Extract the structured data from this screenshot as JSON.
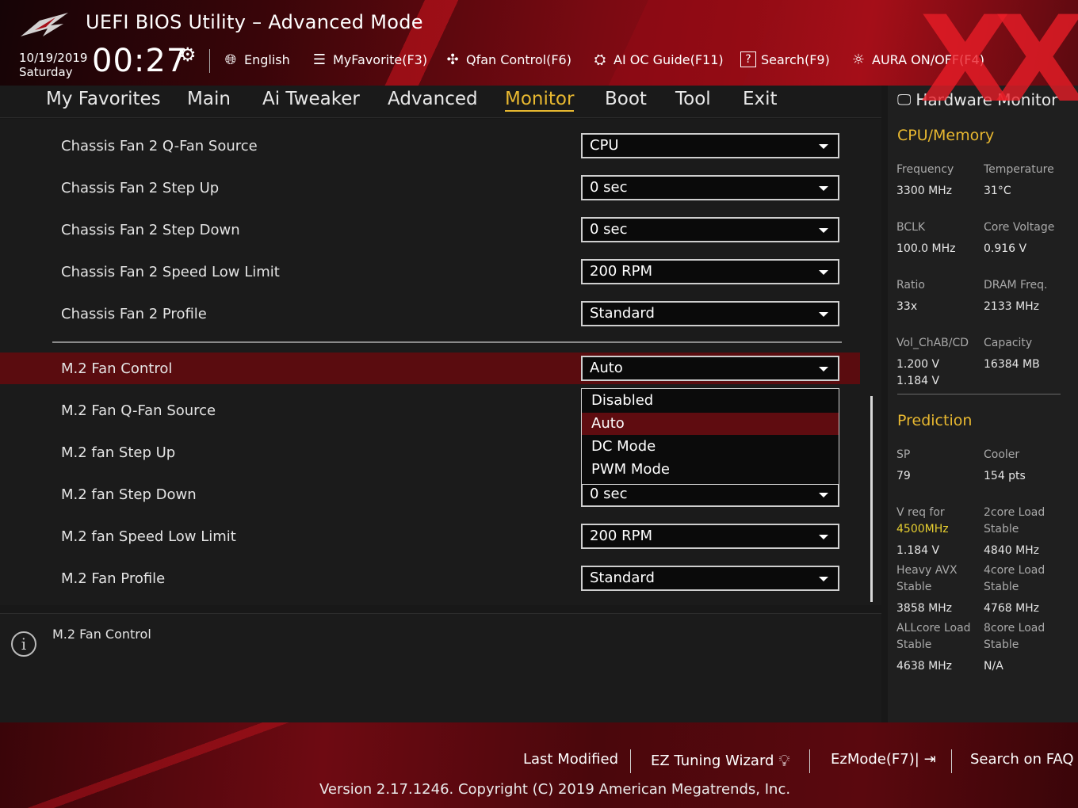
{
  "header": {
    "title": "UEFI BIOS Utility – Advanced Mode",
    "date": "10/19/2019",
    "day": "Saturday",
    "time": "00:27",
    "buttons": [
      {
        "label": "English",
        "icon": "globe-icon"
      },
      {
        "label": "MyFavorite(F3)",
        "icon": "favorite-list-icon"
      },
      {
        "label": "Qfan Control(F6)",
        "icon": "fan-icon"
      },
      {
        "label": "AI OC Guide(F11)",
        "icon": "ai-chip-icon"
      },
      {
        "label": "Search(F9)",
        "icon": "help-search-icon"
      },
      {
        "label": "AURA ON/OFF(F4)",
        "icon": "aura-light-icon"
      }
    ],
    "watermark": "XX"
  },
  "nav": {
    "tabs": [
      "My Favorites",
      "Main",
      "Ai Tweaker",
      "Advanced",
      "Monitor",
      "Boot",
      "Tool",
      "Exit"
    ],
    "active": "Monitor"
  },
  "settings": [
    {
      "label": "Chassis Fan 2 Q-Fan Source",
      "value": "CPU"
    },
    {
      "label": "Chassis Fan 2 Step Up",
      "value": "0 sec"
    },
    {
      "label": "Chassis Fan 2 Step Down",
      "value": "0 sec"
    },
    {
      "label": "Chassis Fan 2 Speed Low Limit",
      "value": "200 RPM"
    },
    {
      "label": "Chassis Fan 2 Profile",
      "value": "Standard"
    },
    {
      "label": "M.2 Fan Control",
      "value": "Auto"
    },
    {
      "label": "M.2 Fan Q-Fan Source",
      "value": ""
    },
    {
      "label": "M.2 fan Step Up",
      "value": ""
    },
    {
      "label": "M.2 fan Step Down",
      "value": "0 sec"
    },
    {
      "label": "M.2 fan Speed Low Limit",
      "value": "200 RPM"
    },
    {
      "label": "M.2 Fan Profile",
      "value": "Standard"
    }
  ],
  "dropdown_options": [
    "Disabled",
    "Auto",
    "DC Mode",
    "PWM Mode"
  ],
  "dropdown_selected": "Auto",
  "info": {
    "text": "M.2 Fan Control"
  },
  "hw_monitor": {
    "title": "Hardware Monitor",
    "cpu_section": "CPU/Memory",
    "frequency_label": "Frequency",
    "frequency": "3300 MHz",
    "temperature_label": "Temperature",
    "temperature": "31°C",
    "bclk_label": "BCLK",
    "bclk": "100.0 MHz",
    "core_voltage_label": "Core Voltage",
    "core_voltage": "0.916 V",
    "ratio_label": "Ratio",
    "ratio": "33x",
    "dram_freq_label": "DRAM Freq.",
    "dram_freq": "2133 MHz",
    "vol_label": "Vol_ChAB/CD",
    "vol_ab": "1.200 V",
    "vol_cd": "1.184 V",
    "capacity_label": "Capacity",
    "capacity": "16384 MB",
    "prediction_section": "Prediction",
    "sp_label": "SP",
    "sp": "79",
    "cooler_label": "Cooler",
    "cooler": "154 pts",
    "vreq_label": "V req for",
    "vreq_freq": "4500MHz",
    "vreq": "1.184 V",
    "core2_label_a": "2core Load",
    "core2_label_b": "Stable",
    "core2": "4840 MHz",
    "avx_label_a": "Heavy AVX",
    "avx_label_b": "Stable",
    "avx": "3858 MHz",
    "core4_label_a": "4core Load",
    "core4_label_b": "Stable",
    "core4": "4768 MHz",
    "allcore_label_a": "ALLcore Load",
    "allcore_label_b": "Stable",
    "allcore": "4638 MHz",
    "core8_label_a": "8core Load",
    "core8_label_b": "Stable",
    "core8": "N/A"
  },
  "footer": {
    "last_modified": "Last Modified",
    "ez_tuning": "EZ Tuning Wizard",
    "ezmode": "EzMode(F7)|",
    "faq": "Search on FAQ",
    "version": "Version 2.17.1246. Copyright (C) 2019 American Megatrends, Inc."
  },
  "colors": {
    "accent": "#e8b830",
    "selection": "#5a0c0f",
    "brand_red": "#a50e18"
  }
}
